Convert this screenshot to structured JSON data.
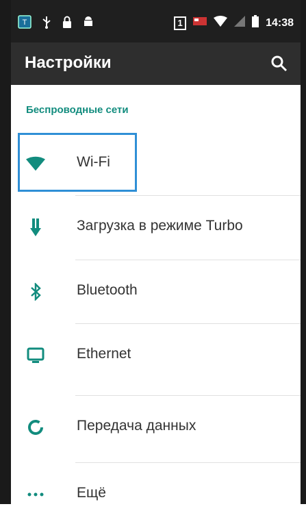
{
  "status_bar": {
    "time": "14:38",
    "sim_number": "1",
    "left_icons": [
      "app-icon",
      "usb-icon",
      "lock-icon",
      "android-icon"
    ],
    "right_icons": [
      "sim-icon",
      "flag-icon",
      "wifi-signal-icon",
      "no-signal-icon",
      "battery-icon"
    ]
  },
  "app_bar": {
    "title": "Настройки"
  },
  "section": {
    "title": "Беспроводные сети"
  },
  "items": [
    {
      "label": "Wi-Fi",
      "icon": "wifi-icon"
    },
    {
      "label": "Загрузка в режиме Turbo",
      "icon": "download-icon"
    },
    {
      "label": "Bluetooth",
      "icon": "bluetooth-icon"
    },
    {
      "label": "Ethernet",
      "icon": "monitor-icon"
    },
    {
      "label": "Передача данных",
      "icon": "data-usage-icon"
    },
    {
      "label": "Ещё",
      "icon": "more-icon"
    }
  ],
  "colors": {
    "accent": "#128c7e",
    "highlight": "#2f8fd6",
    "status_bar": "#1f1f1f",
    "app_bar": "#2e2e2e"
  }
}
